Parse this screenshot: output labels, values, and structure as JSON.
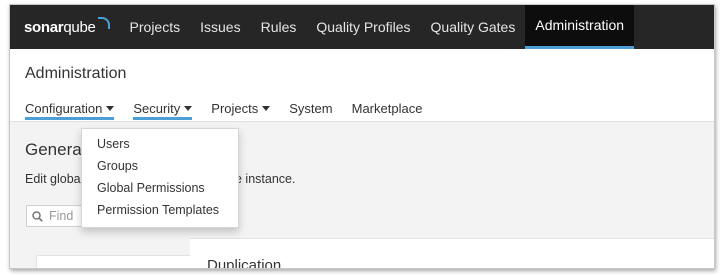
{
  "topnav": {
    "logo_main": "sonar",
    "logo_accent": "qube",
    "items": [
      {
        "label": "Projects"
      },
      {
        "label": "Issues"
      },
      {
        "label": "Rules"
      },
      {
        "label": "Quality Profiles"
      },
      {
        "label": "Quality Gates"
      },
      {
        "label": "Administration",
        "active": true
      }
    ]
  },
  "header": {
    "title": "Administration",
    "subnav": [
      {
        "label": "Configuration",
        "dropdown": true
      },
      {
        "label": "Security",
        "dropdown": true
      },
      {
        "label": "Projects",
        "dropdown": true
      },
      {
        "label": "System",
        "dropdown": false
      },
      {
        "label": "Marketplace",
        "dropdown": false
      }
    ]
  },
  "security_menu": {
    "items": [
      "Users",
      "Groups",
      "Global Permissions",
      "Permission Templates"
    ]
  },
  "main": {
    "section_title_partial": "Genera",
    "description_start": "Edit globa",
    "description_end": "e instance.",
    "search_placeholder": "Find",
    "card_heading_partial": "Duplication"
  },
  "colors": {
    "topbar": "#262626",
    "accent": "#4b9fd5"
  }
}
